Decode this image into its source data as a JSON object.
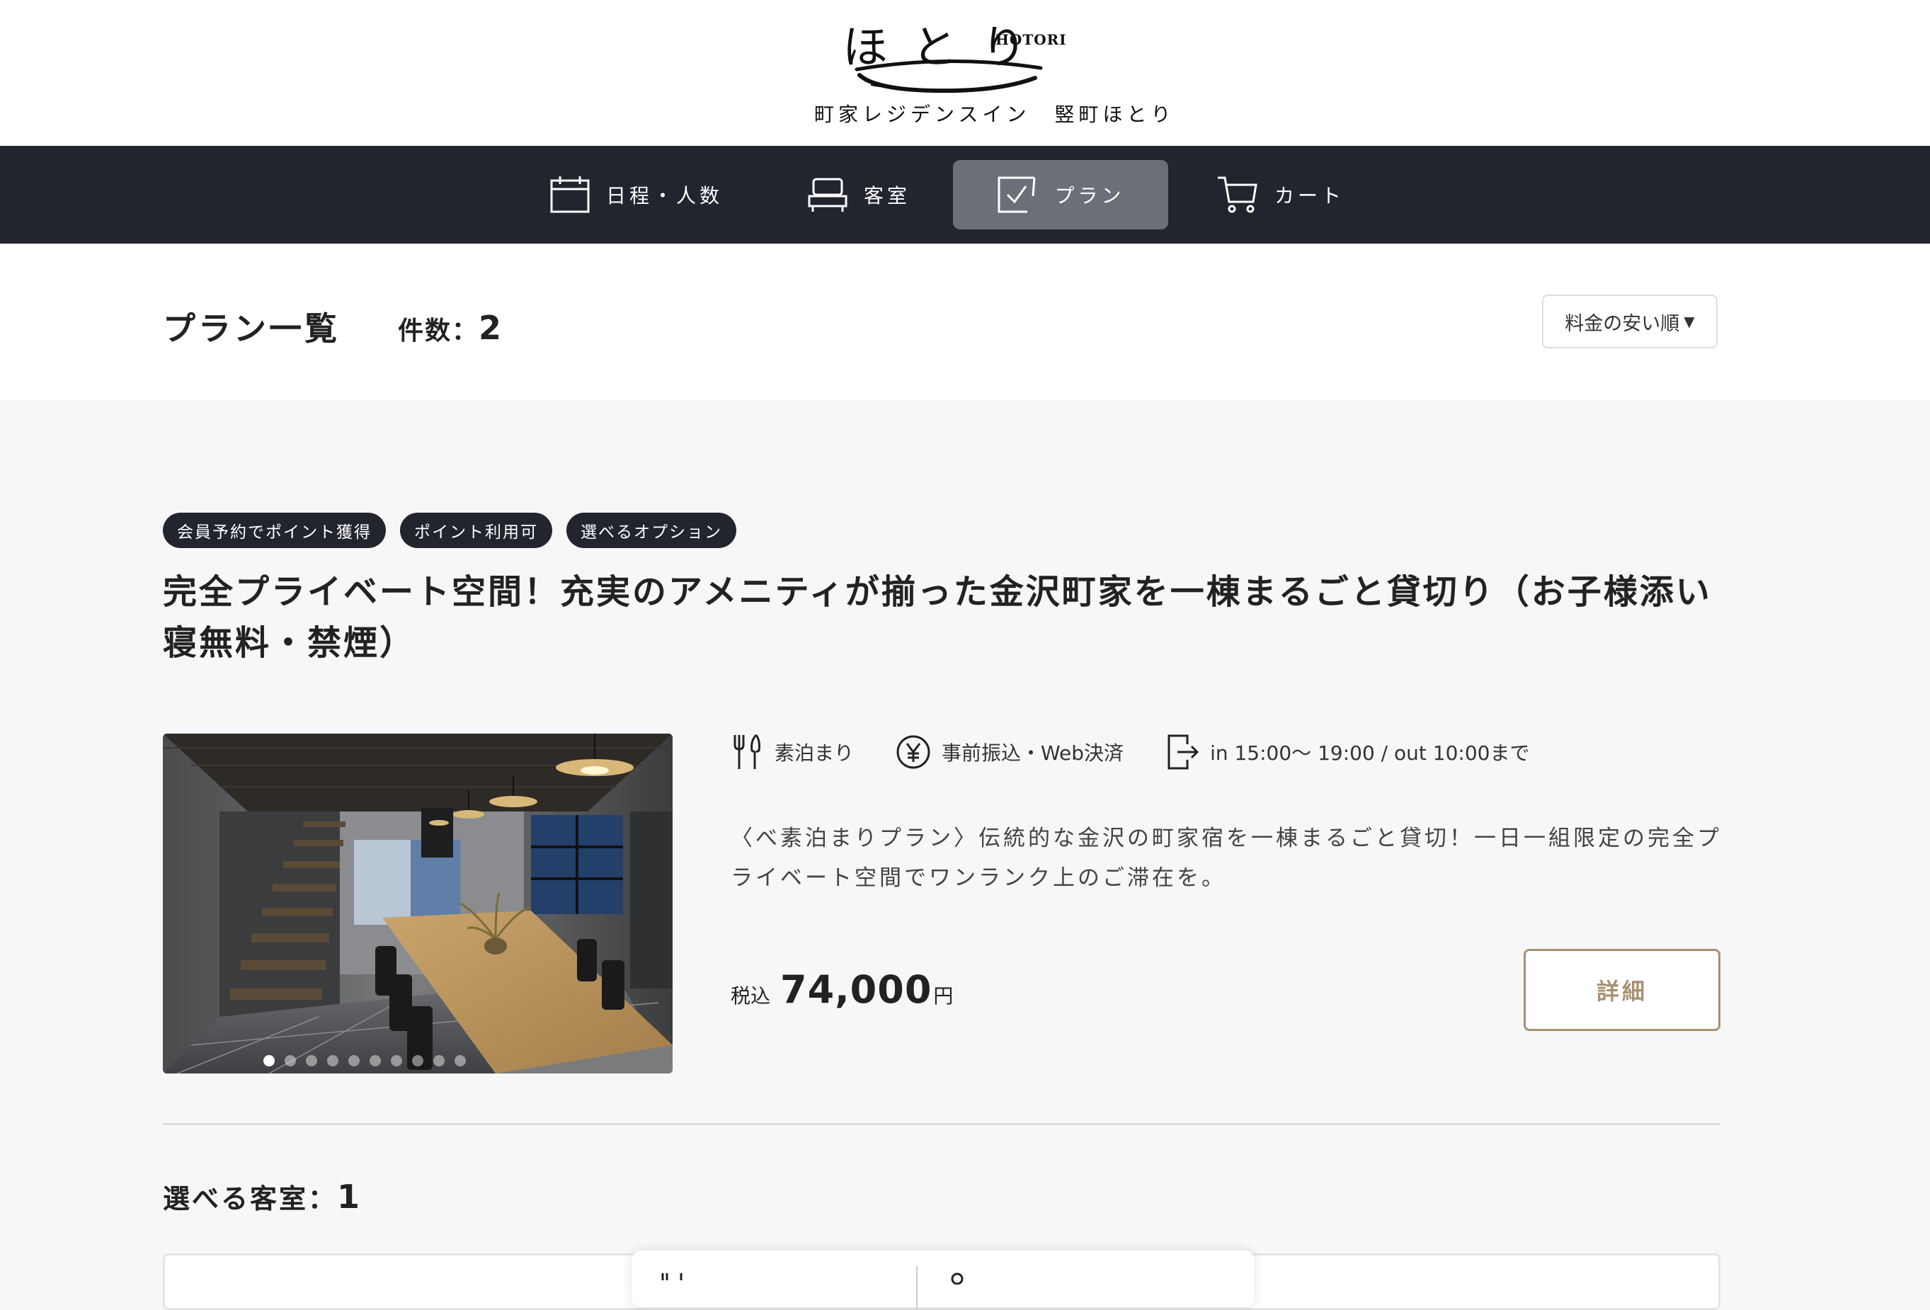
{
  "brand": {
    "logo_script": "ほとり",
    "logo_roman": "HOTORI",
    "subtitle": "町家レジデンスイン　竪町ほとり"
  },
  "nav": {
    "items": [
      {
        "label": "日程・人数",
        "icon": "calendar-icon"
      },
      {
        "label": "客室",
        "icon": "sofa-icon"
      },
      {
        "label": "プラン",
        "icon": "checklist-icon",
        "active": true
      },
      {
        "label": "カート",
        "icon": "cart-icon"
      }
    ]
  },
  "list": {
    "title": "プラン一覧",
    "count_label": "件数：",
    "count": "2",
    "sort_label": "料金の安い順",
    "sort_arrow": "▼"
  },
  "plan": {
    "tags": [
      "会員予約でポイント獲得",
      "ポイント利用可",
      "選べるオプション"
    ],
    "title": "完全プライベート空間！充実のアメニティが揃った金沢町家を一棟まるごと貸切り（お子様添い寝無料・禁煙）",
    "meal": "素泊まり",
    "payment": "事前振込・Web決済",
    "checkin": "in 15:00〜 19:00 / out 10:00まで",
    "description": "〈べ素泊まりプラン〉伝統的な金沢の町家宿を一棟まるごと貸切！一日一組限定の完全プライベート空間でワンランク上のご滞在を。",
    "price_tax_label": "税込",
    "price": "74,000",
    "price_unit": "円",
    "detail_button": "詳細",
    "image_count": 10,
    "image_active_index": 0
  },
  "rooms": {
    "label": "選べる客室：",
    "count": "1"
  },
  "colors": {
    "nav_bg": "#22252e",
    "active_tab": "#6c6f78",
    "accent_gold": "#a89172"
  }
}
